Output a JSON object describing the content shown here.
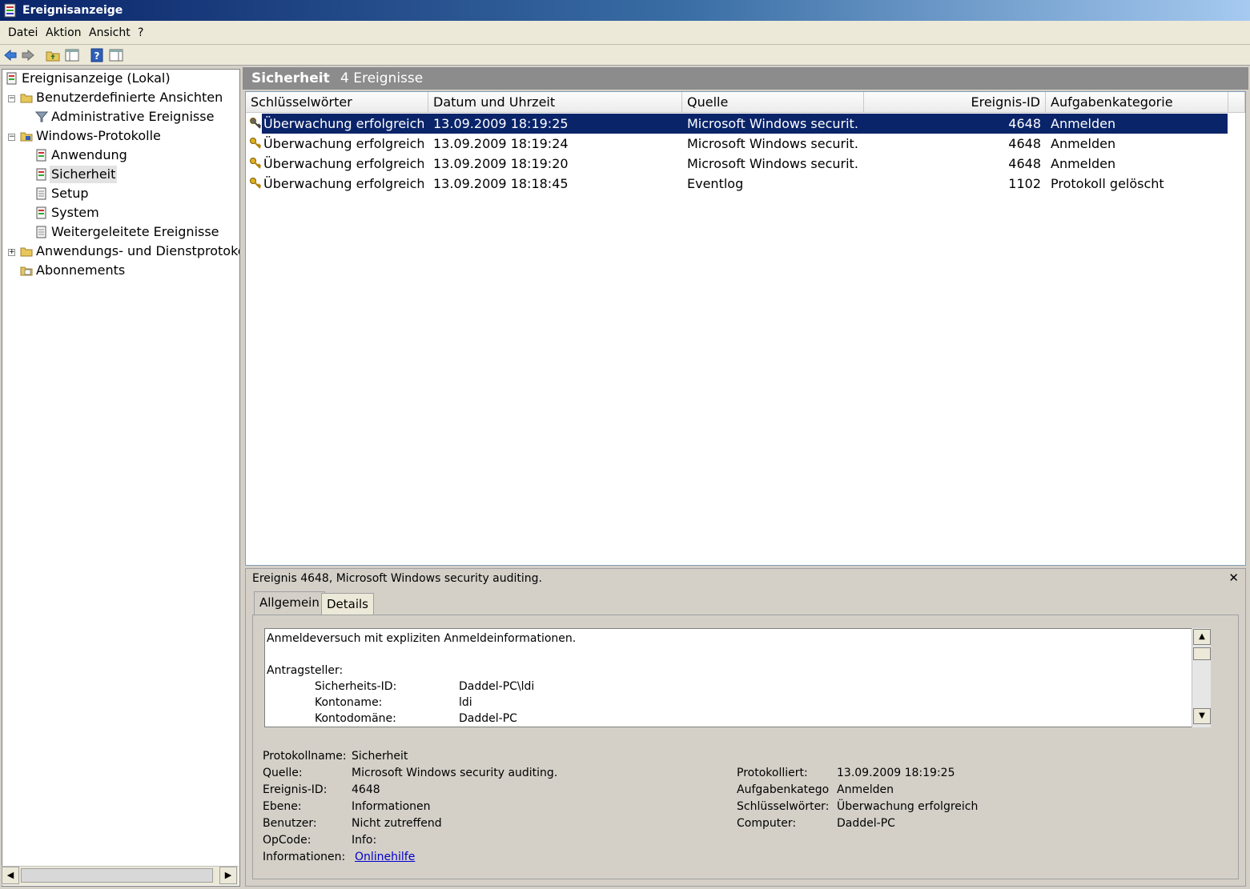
{
  "window": {
    "title": "Ereignisanzeige"
  },
  "menu": {
    "datei": "Datei",
    "aktion": "Aktion",
    "ansicht": "Ansicht",
    "help": "?"
  },
  "toolbar": {
    "icons": [
      "back-icon",
      "forward-icon",
      "up-folder-icon",
      "show-hide-tree-icon",
      "help-icon",
      "show-hide-action-pane-icon"
    ]
  },
  "tree": {
    "root": "Ereignisanzeige (Lokal)",
    "custom_views": "Benutzerdefinierte Ansichten",
    "admin_events": "Administrative Ereignisse",
    "windows_logs": "Windows-Protokolle",
    "app": "Anwendung",
    "security": "Sicherheit",
    "setup": "Setup",
    "system": "System",
    "forwarded": "Weitergeleitete Ereignisse",
    "app_service_logs": "Anwendungs- und Dienstprotokolle",
    "subscriptions": "Abonnements",
    "selected": "Sicherheit"
  },
  "log": {
    "name": "Sicherheit",
    "count_text": "4 Ereignisse"
  },
  "columns": [
    "Schlüsselwörter",
    "Datum und Uhrzeit",
    "Quelle",
    "Ereignis-ID",
    "Aufgabenkategorie"
  ],
  "events": [
    {
      "keywords": "Überwachung erfolgreich",
      "datetime": "13.09.2009 18:19:25",
      "source": "Microsoft Windows securit...",
      "id": "4648",
      "category": "Anmelden",
      "selected": true
    },
    {
      "keywords": "Überwachung erfolgreich",
      "datetime": "13.09.2009 18:19:24",
      "source": "Microsoft Windows securit...",
      "id": "4648",
      "category": "Anmelden",
      "selected": false
    },
    {
      "keywords": "Überwachung erfolgreich",
      "datetime": "13.09.2009 18:19:20",
      "source": "Microsoft Windows securit...",
      "id": "4648",
      "category": "Anmelden",
      "selected": false
    },
    {
      "keywords": "Überwachung erfolgreich",
      "datetime": "13.09.2009 18:18:45",
      "source": "Eventlog",
      "id": "1102",
      "category": "Protokoll gelöscht",
      "selected": false
    }
  ],
  "detail": {
    "title": "Ereignis 4648, Microsoft Windows security auditing.",
    "tabs": [
      "Allgemein",
      "Details"
    ],
    "active_tab": "Allgemein",
    "message": {
      "line1": "Anmeldeversuch mit expliziten Anmeldeinformationen.",
      "section": "Antragsteller:",
      "fields": [
        {
          "label": "Sicherheits-ID:",
          "value": "Daddel-PC\\ldi"
        },
        {
          "label": "Kontoname:",
          "value": "ldi"
        },
        {
          "label": "Kontodomäne:",
          "value": "Daddel-PC"
        }
      ]
    },
    "props_left": [
      {
        "label": "Protokollname:",
        "value": "Sicherheit"
      },
      {
        "label": "Quelle:",
        "value": "Microsoft Windows security auditing."
      },
      {
        "label": "Ereignis-ID:",
        "value": "4648"
      },
      {
        "label": "Ebene:",
        "value": "Informationen"
      },
      {
        "label": "Benutzer:",
        "value": "Nicht zutreffend"
      },
      {
        "label": "OpCode:",
        "value": "Info:"
      },
      {
        "label": "Informationen:",
        "value": "Onlinehilfe"
      }
    ],
    "props_right": [
      {
        "label": "Protokolliert:",
        "value": "13.09.2009 18:19:25"
      },
      {
        "label": "Aufgabenkatego",
        "value": "Anmelden"
      },
      {
        "label": "Schlüsselwörter:",
        "value": "Überwachung erfolgreich"
      },
      {
        "label": "Computer:",
        "value": "Daddel-PC"
      }
    ]
  }
}
